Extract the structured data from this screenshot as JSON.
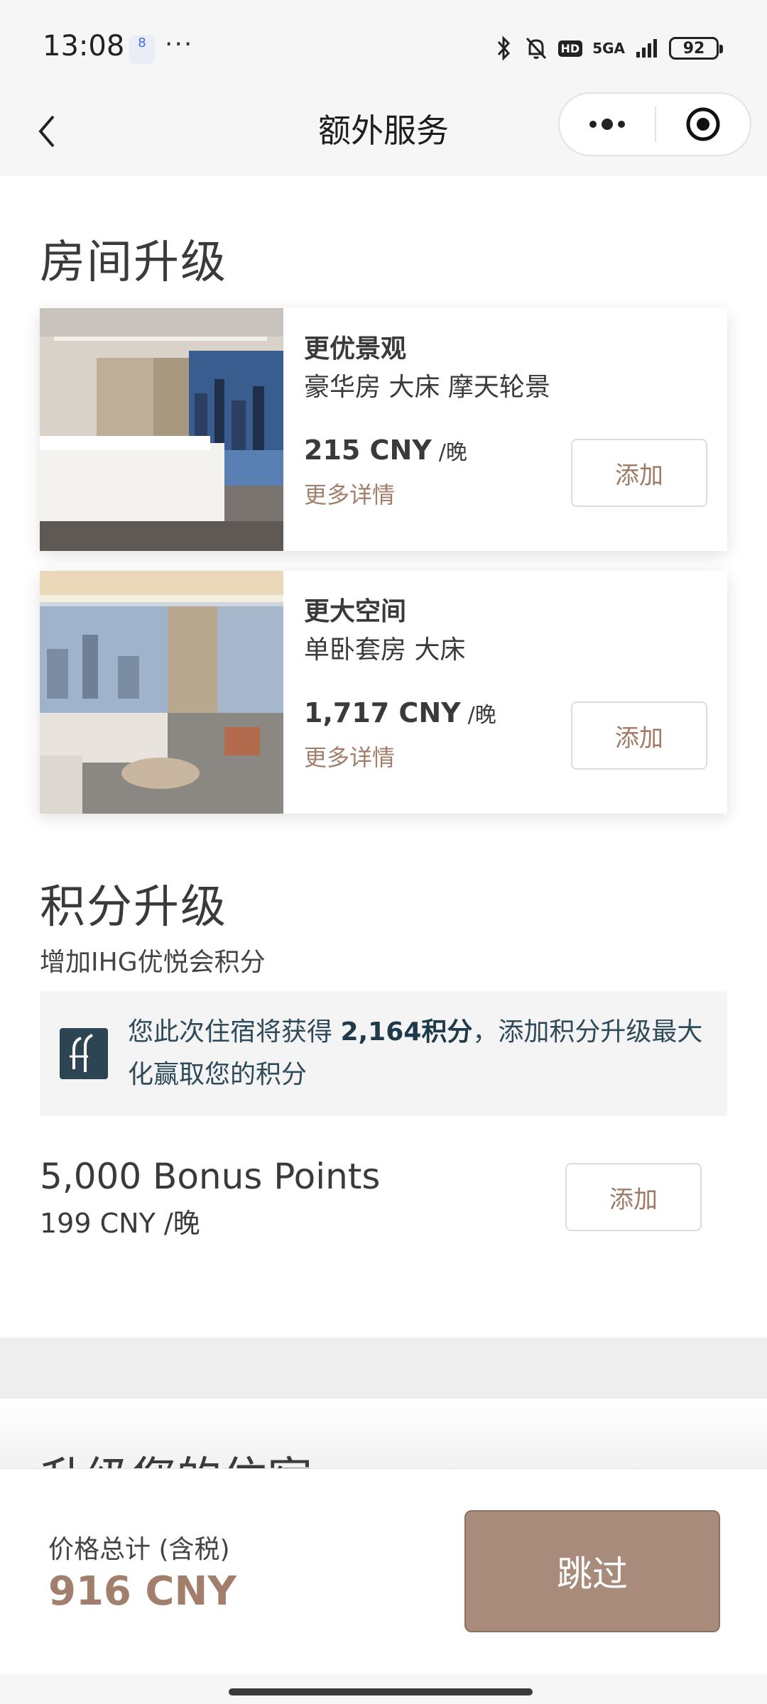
{
  "status_bar": {
    "time": "13:08",
    "app_badge": "8",
    "more_dots": "···",
    "network": "5GA",
    "hd": "HD",
    "battery": "92",
    "icons": [
      "bluetooth-icon",
      "bell-muted-icon",
      "signal-icon",
      "battery-icon"
    ]
  },
  "nav": {
    "title": "额外服务",
    "back_icon": "chevron-left-icon",
    "more_icon": "more-dots-icon",
    "close_icon": "target-close-icon"
  },
  "room_upgrade": {
    "title": "房间升级",
    "cards": [
      {
        "category": "更优景观",
        "description": "豪华房 大床 摩天轮景",
        "price": "215 CNY",
        "unit": "/晚",
        "details_link": "更多详情",
        "add_label": "添加"
      },
      {
        "category": "更大空间",
        "description": "单卧套房 大床",
        "price": "1,717 CNY",
        "unit": "/晚",
        "details_link": "更多详情",
        "add_label": "添加"
      }
    ]
  },
  "points_upgrade": {
    "title": "积分升级",
    "subtitle": "增加IHG优悦会积分",
    "info_prefix": "您此次住宿将获得 ",
    "info_points": "2,164积分",
    "info_suffix": "，添加积分升级最大化赢取您的积分",
    "bonus_name": "5,000 Bonus Points",
    "bonus_price": "199 CNY /晚",
    "add_label": "添加"
  },
  "next_section_partial": "升级您的住宿",
  "bottom_bar": {
    "total_label": "价格总计 (含税)",
    "total_price": "916 CNY",
    "skip_label": "跳过"
  },
  "colors": {
    "accent": "#a27f6c",
    "skip_button": "#a98b7c",
    "info_bg": "#f4f4f4",
    "logo_bg": "#2d4453"
  }
}
